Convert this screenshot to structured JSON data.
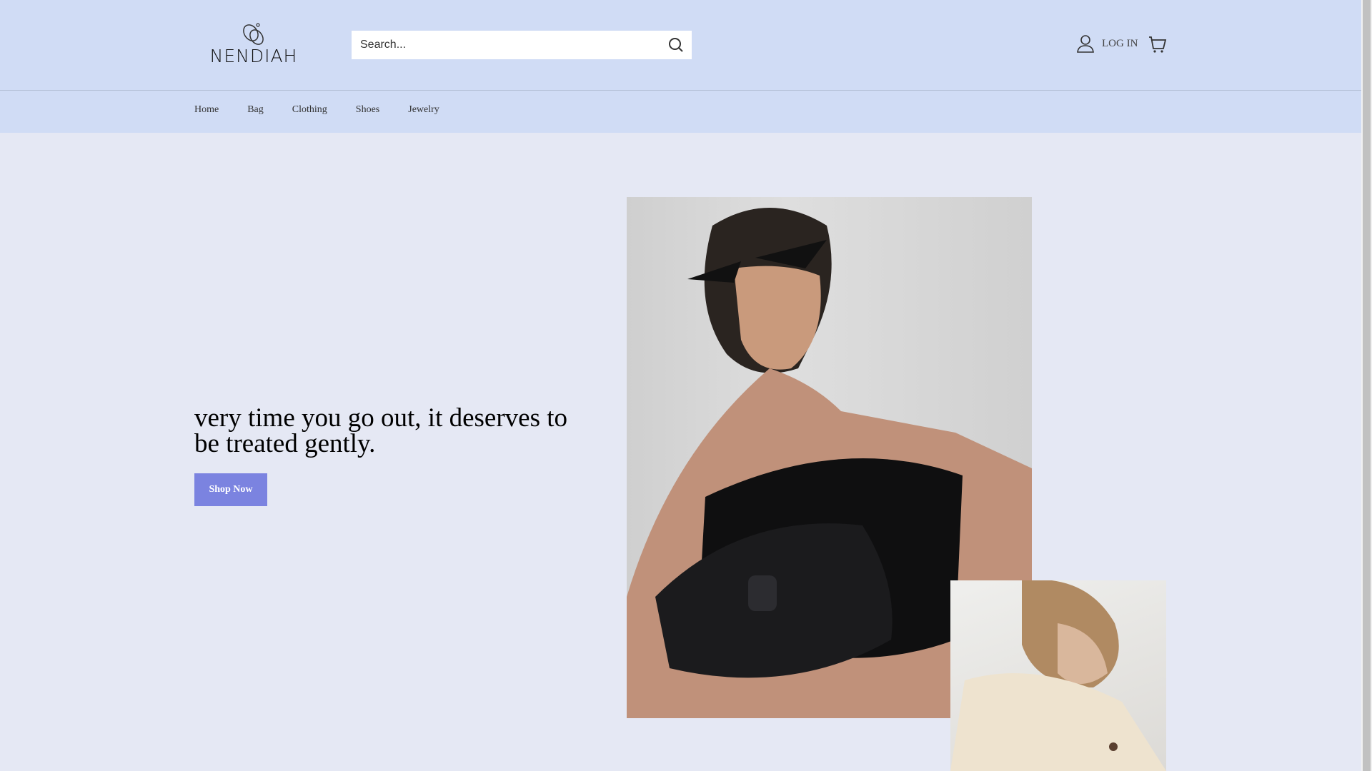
{
  "brand": {
    "name": "NENDIAH"
  },
  "search": {
    "placeholder": "Search..."
  },
  "account": {
    "login_label": "LOG IN"
  },
  "nav": {
    "items": [
      {
        "label": "Home"
      },
      {
        "label": "Bag"
      },
      {
        "label": "Clothing"
      },
      {
        "label": "Shoes"
      },
      {
        "label": "Jewelry"
      }
    ]
  },
  "hero": {
    "title": "very time you go out, it deserves to be treated gently.",
    "cta_label": "Shop Now"
  },
  "colors": {
    "header_bg": "#d0dcf5",
    "page_bg": "#e5e8f4",
    "accent": "#7b83e0"
  }
}
